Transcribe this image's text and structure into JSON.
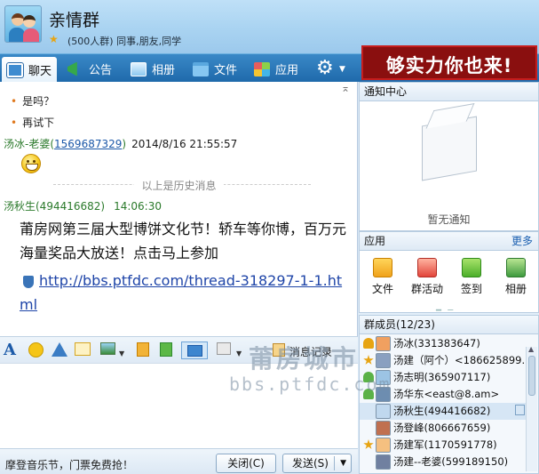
{
  "header": {
    "group_name": "亲情群",
    "group_sub": "(500人群) 同事,朋友,同学"
  },
  "toolbar": {
    "tabs": [
      {
        "label": "聊天",
        "icon": "chat-icon"
      },
      {
        "label": "公告",
        "icon": "notice-icon"
      },
      {
        "label": "相册",
        "icon": "album-icon"
      },
      {
        "label": "文件",
        "icon": "folder-icon"
      },
      {
        "label": "应用",
        "icon": "apps-icon"
      }
    ],
    "banner": "够实力你也来!"
  },
  "chat": {
    "lines": [
      "是吗？",
      "再试下"
    ],
    "msg1": {
      "sender": "汤冰-老婆",
      "qq": "1569687329",
      "time": "2014/8/16 21:55:57"
    },
    "history_divider": "以上是历史消息",
    "msg2": {
      "sender": "汤秋生(494416682)",
      "time": "14:06:30",
      "text": "莆房网第三届大型博饼文化节！轿车等你博，百万元海量奖品大放送！点击马上参加",
      "link": "http://bbs.ptfdc.com/thread-318297-1-1.html"
    }
  },
  "input_toolbar": {
    "history_label": "消息记录"
  },
  "bottom": {
    "ad_text": "摩登音乐节，门票免费抢！",
    "close_label": "关闭(C)",
    "send_label": "发送(S)"
  },
  "notice_center": {
    "title": "通知中心",
    "empty_text": "暂无通知"
  },
  "apps": {
    "title": "应用",
    "more": "更多",
    "items": [
      {
        "label": "文件",
        "icon": "folder-icon"
      },
      {
        "label": "群活动",
        "icon": "activity-flag-icon"
      },
      {
        "label": "签到",
        "icon": "checkin-icon"
      },
      {
        "label": "相册",
        "icon": "album-icon"
      }
    ]
  },
  "members": {
    "title": "群成员(12/23)",
    "list": [
      {
        "name": "汤冰(331383647)",
        "role": "owner",
        "face": "#f0a060"
      },
      {
        "name": "汤建（阿个）<186625899...",
        "role": "admin",
        "face": "#8aa0c0"
      },
      {
        "name": "汤志明(365907117)",
        "role": "member",
        "face": "#9cc4e4"
      },
      {
        "name": "汤华东<east@8.am>",
        "role": "member",
        "face": "#6d8db0"
      },
      {
        "name": "汤秋生(494416682)",
        "role": "",
        "face": "#c0d8ee"
      },
      {
        "name": "汤登峰(806667659)",
        "role": "",
        "face": "#c07050"
      },
      {
        "name": "汤建军(1170591778)",
        "role": "admin",
        "face": "#f5c080"
      },
      {
        "name": "汤建--老婆(599189150)",
        "role": "",
        "face": "#7080a0"
      }
    ]
  },
  "watermark": {
    "cn": "莆房城市",
    "url": "bbs.ptfdc.com"
  },
  "colors": {
    "toolbar": "#1f6aab",
    "banner": "#8a0f0f",
    "link": "#1f45a8",
    "sender": "#2b7a2b"
  }
}
